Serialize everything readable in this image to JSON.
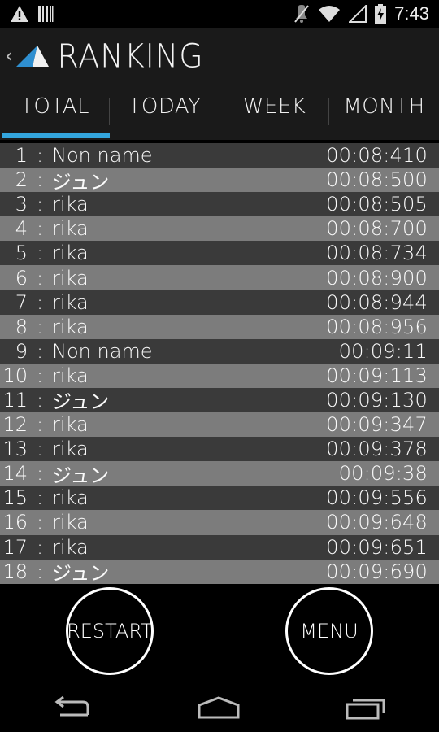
{
  "status_bar": {
    "time": "7:43",
    "icons": [
      "warning-icon",
      "barcode-icon",
      "mute-icon",
      "wifi-icon",
      "signal-icon",
      "battery-charging-icon"
    ]
  },
  "header": {
    "title": "RANKING",
    "back_icon": "chevron-left-icon",
    "logo_icon": "triangle-logo-icon"
  },
  "tabs": [
    {
      "label": "TOTAL",
      "selected": true
    },
    {
      "label": "TODAY",
      "selected": false
    },
    {
      "label": "WEEK",
      "selected": false
    },
    {
      "label": "MONTH",
      "selected": false
    }
  ],
  "separator": ":",
  "ranking": [
    {
      "rank": "1",
      "name": "Non name",
      "time": "00:08:410"
    },
    {
      "rank": "2",
      "name": "ジュン",
      "time": "00:08:500"
    },
    {
      "rank": "3",
      "name": "rika",
      "time": "00:08:505"
    },
    {
      "rank": "4",
      "name": "rika",
      "time": "00:08:700"
    },
    {
      "rank": "5",
      "name": "rika",
      "time": "00:08:734"
    },
    {
      "rank": "6",
      "name": "rika",
      "time": "00:08:900"
    },
    {
      "rank": "7",
      "name": "rika",
      "time": "00:08:944"
    },
    {
      "rank": "8",
      "name": "rika",
      "time": "00:08:956"
    },
    {
      "rank": "9",
      "name": "Non name",
      "time": "00:09:11"
    },
    {
      "rank": "10",
      "name": "rika",
      "time": "00:09:113"
    },
    {
      "rank": "11",
      "name": "ジュン",
      "time": "00:09:130"
    },
    {
      "rank": "12",
      "name": "rika",
      "time": "00:09:347"
    },
    {
      "rank": "13",
      "name": "rika",
      "time": "00:09:378"
    },
    {
      "rank": "14",
      "name": "ジュン",
      "time": "00:09:38"
    },
    {
      "rank": "15",
      "name": "rika",
      "time": "00:09:556"
    },
    {
      "rank": "16",
      "name": "rika",
      "time": "00:09:648"
    },
    {
      "rank": "17",
      "name": "rika",
      "time": "00:09:651"
    },
    {
      "rank": "18",
      "name": "ジュン",
      "time": "00:09:690"
    }
  ],
  "buttons": {
    "restart": "RESTART",
    "menu": "MENU"
  },
  "nav_bar": {
    "icons": [
      "back-icon",
      "home-icon",
      "recents-icon"
    ]
  },
  "colors": {
    "accent": "#33a5dd",
    "row_dark": "#3a3a3a",
    "row_light": "#7c7c7c",
    "bar_bg": "#1a1a1a"
  }
}
